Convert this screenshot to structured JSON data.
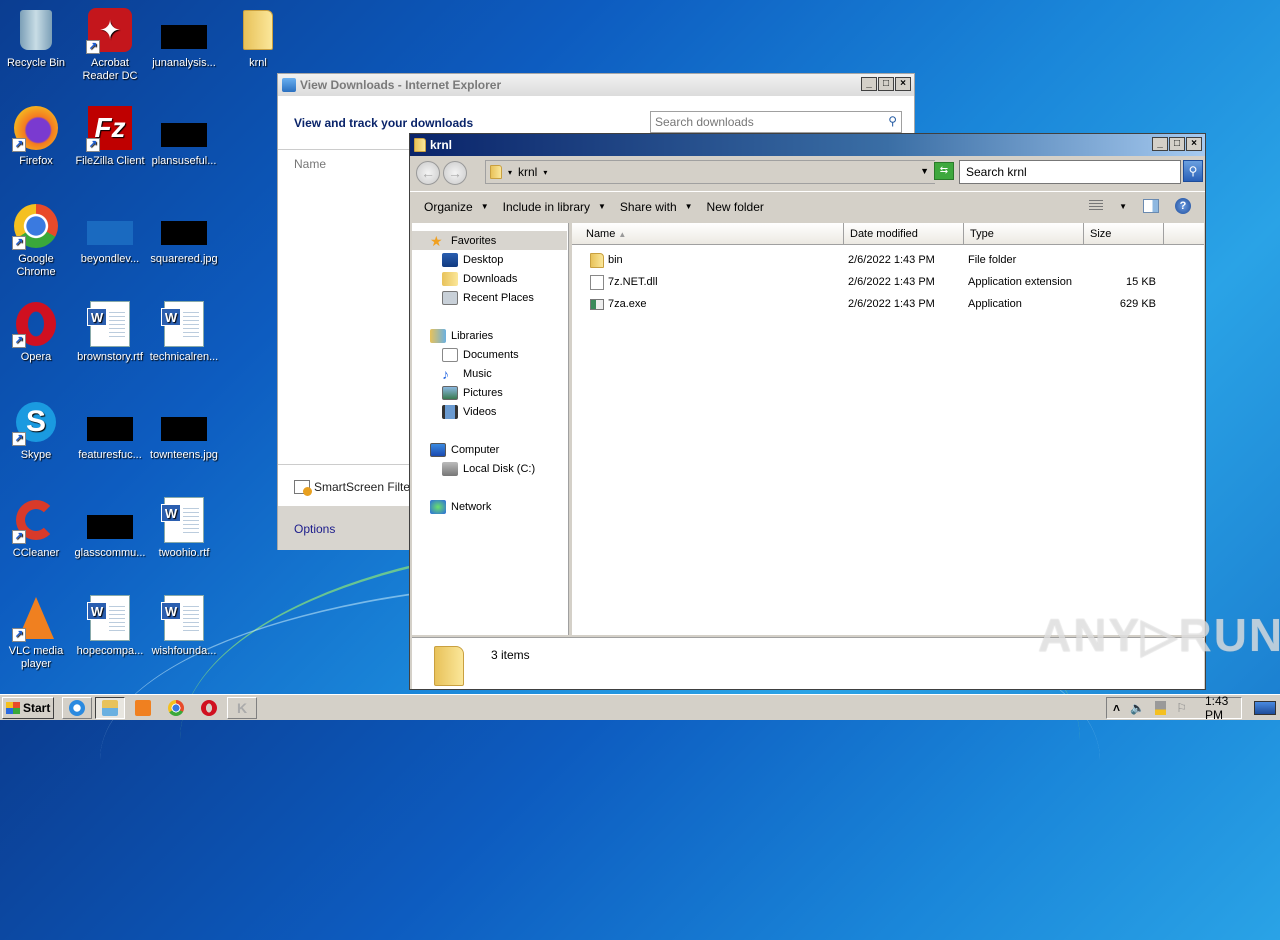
{
  "desktop": {
    "icons": [
      {
        "label": "Recycle Bin",
        "icon": "recycle-bin-icon"
      },
      {
        "label": "Acrobat Reader DC",
        "icon": "acrobat-icon"
      },
      {
        "label": "junanalysis...",
        "icon": "image-thumbnail-icon"
      },
      {
        "label": "krnl",
        "icon": "folder-icon"
      },
      {
        "label": "Firefox",
        "icon": "firefox-icon"
      },
      {
        "label": "FileZilla Client",
        "icon": "filezilla-icon"
      },
      {
        "label": "plansuseful...",
        "icon": "image-thumbnail-icon"
      },
      {
        "label": "Google Chrome",
        "icon": "chrome-icon"
      },
      {
        "label": "beyondlev...",
        "icon": "image-thumbnail-icon"
      },
      {
        "label": "squarered.jpg",
        "icon": "image-thumbnail-icon"
      },
      {
        "label": "Opera",
        "icon": "opera-icon"
      },
      {
        "label": "brownstory.rtf",
        "icon": "word-document-icon"
      },
      {
        "label": "technicalren...",
        "icon": "word-document-icon"
      },
      {
        "label": "Skype",
        "icon": "skype-icon"
      },
      {
        "label": "featuresfuc...",
        "icon": "image-thumbnail-icon"
      },
      {
        "label": "townteens.jpg",
        "icon": "image-thumbnail-icon"
      },
      {
        "label": "CCleaner",
        "icon": "ccleaner-icon"
      },
      {
        "label": "glasscommu...",
        "icon": "image-thumbnail-icon"
      },
      {
        "label": "twoohio.rtf",
        "icon": "word-document-icon"
      },
      {
        "label": "VLC media player",
        "icon": "vlc-icon"
      },
      {
        "label": "hopecompa...",
        "icon": "word-document-icon"
      },
      {
        "label": "wishfounda...",
        "icon": "word-document-icon"
      }
    ]
  },
  "ie_window": {
    "title": "View Downloads - Internet Explorer",
    "heading": "View and track your downloads",
    "search_placeholder": "Search downloads",
    "column_name": "Name",
    "smartscreen_label": "SmartScreen Filte",
    "options_label": "Options"
  },
  "explorer": {
    "title": "krnl",
    "address_path": "krnl",
    "search_placeholder": "Search krnl",
    "commands": {
      "organize": "Organize",
      "include_in_library": "Include in library",
      "share_with": "Share with",
      "new_folder": "New folder"
    },
    "nav": {
      "favorites": "Favorites",
      "desktop": "Desktop",
      "downloads": "Downloads",
      "recent_places": "Recent Places",
      "libraries": "Libraries",
      "documents": "Documents",
      "music": "Music",
      "pictures": "Pictures",
      "videos": "Videos",
      "computer": "Computer",
      "local_disk": "Local Disk (C:)",
      "network": "Network"
    },
    "columns": {
      "name": "Name",
      "date": "Date modified",
      "type": "Type",
      "size": "Size"
    },
    "files": [
      {
        "name": "bin",
        "date": "2/6/2022 1:43 PM",
        "type": "File folder",
        "size": ""
      },
      {
        "name": "7z.NET.dll",
        "date": "2/6/2022 1:43 PM",
        "type": "Application extension",
        "size": "15 KB"
      },
      {
        "name": "7za.exe",
        "date": "2/6/2022 1:43 PM",
        "type": "Application",
        "size": "629 KB"
      }
    ],
    "item_count": "3 items"
  },
  "watermark": "ANY▷RUN",
  "taskbar": {
    "start_label": "Start",
    "clock": "1:43 PM",
    "tray_expand": "˄"
  }
}
